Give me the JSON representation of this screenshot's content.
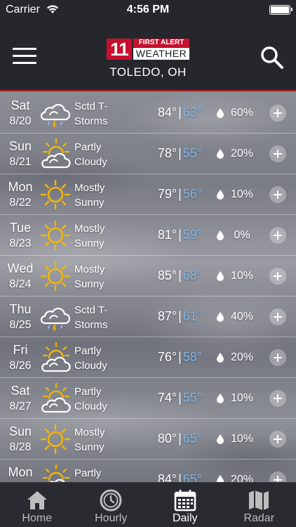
{
  "status_bar": {
    "carrier": "Carrier",
    "time": "4:56 PM"
  },
  "header": {
    "logo_number": "11",
    "logo_top": "FIRST ALERT",
    "logo_bottom": "WEATHER",
    "city": "TOLEDO, OH"
  },
  "forecast": [
    {
      "day": "Sat",
      "date": "8/20",
      "icon": "storm-cloud-icon",
      "cond1": "Sctd T-",
      "cond2": "Storms",
      "hi": "84°",
      "lo": "63°",
      "precip": "60%"
    },
    {
      "day": "Sun",
      "date": "8/21",
      "icon": "partly-cloudy-icon",
      "cond1": "Partly",
      "cond2": "Cloudy",
      "hi": "78°",
      "lo": "55°",
      "precip": "20%"
    },
    {
      "day": "Mon",
      "date": "8/22",
      "icon": "sun-icon",
      "cond1": "Mostly",
      "cond2": "Sunny",
      "hi": "79°",
      "lo": "56°",
      "precip": "10%"
    },
    {
      "day": "Tue",
      "date": "8/23",
      "icon": "sun-icon",
      "cond1": "Mostly",
      "cond2": "Sunny",
      "hi": "81°",
      "lo": "59°",
      "precip": "0%"
    },
    {
      "day": "Wed",
      "date": "8/24",
      "icon": "sun-icon",
      "cond1": "Mostly",
      "cond2": "Sunny",
      "hi": "85°",
      "lo": "68°",
      "precip": "10%"
    },
    {
      "day": "Thu",
      "date": "8/25",
      "icon": "storm-cloud-icon",
      "cond1": "Sctd T-",
      "cond2": "Storms",
      "hi": "87°",
      "lo": "61°",
      "precip": "40%"
    },
    {
      "day": "Fri",
      "date": "8/26",
      "icon": "partly-cloudy-icon",
      "cond1": "Partly",
      "cond2": "Cloudy",
      "hi": "76°",
      "lo": "58°",
      "precip": "20%"
    },
    {
      "day": "Sat",
      "date": "8/27",
      "icon": "partly-cloudy-icon",
      "cond1": "Partly",
      "cond2": "Cloudy",
      "hi": "74°",
      "lo": "55°",
      "precip": "10%"
    },
    {
      "day": "Sun",
      "date": "8/28",
      "icon": "sun-icon",
      "cond1": "Mostly",
      "cond2": "Sunny",
      "hi": "80°",
      "lo": "65°",
      "precip": "10%"
    },
    {
      "day": "Mon",
      "date": "",
      "icon": "partly-cloudy-icon",
      "cond1": "Partly",
      "cond2": "",
      "hi": "84°",
      "lo": "65°",
      "precip": "20%"
    }
  ],
  "tabs": [
    {
      "label": "Home",
      "icon": "home-icon"
    },
    {
      "label": "Hourly",
      "icon": "clock-icon"
    },
    {
      "label": "Daily",
      "icon": "calendar-icon",
      "active": true
    },
    {
      "label": "Radar",
      "icon": "map-icon"
    }
  ],
  "colors": {
    "header_bg": "#26272c",
    "accent_red": "#c8102e",
    "low_temp": "#7fb6e6",
    "tabbar_bg": "#2a2b30"
  }
}
